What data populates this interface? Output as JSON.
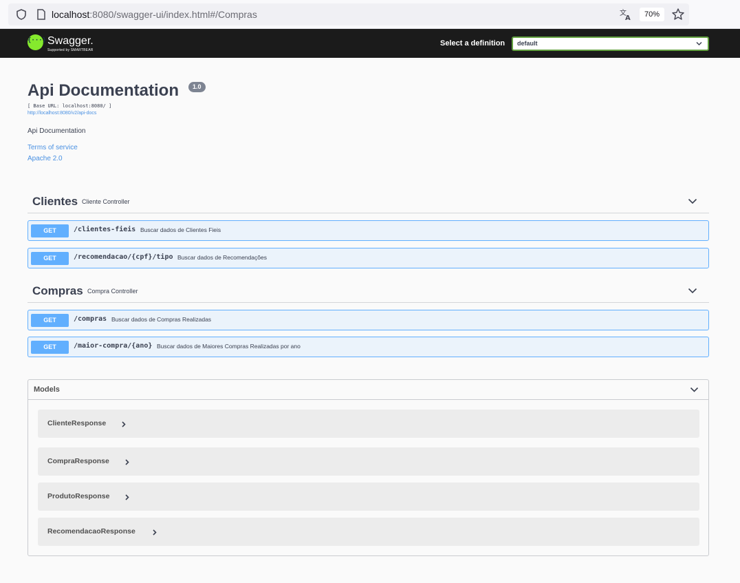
{
  "browser": {
    "url_host": "localhost",
    "url_rest": ":8080/swagger-ui/index.html#/Compras",
    "zoom": "70%"
  },
  "topbar": {
    "logo_icon_text": "{···}",
    "logo_title": "Swagger.",
    "logo_subtitle": "Supported by SMARTBEAR",
    "definition_label": "Select a definition",
    "definition_value": "default"
  },
  "info": {
    "title": "Api Documentation",
    "version": "1.0",
    "base_url": "[ Base URL: localhost:8080/ ]",
    "api_docs_link": "http://localhost:8080/v2/api-docs",
    "description": "Api Documentation",
    "terms_link": "Terms of service",
    "license_link": "Apache 2.0"
  },
  "tags": [
    {
      "name": "Clientes",
      "description": "Cliente Controller",
      "operations": [
        {
          "method": "GET",
          "path": "/clientes-fieis",
          "summary": "Buscar dados de Clientes Fieis"
        },
        {
          "method": "GET",
          "path": "/recomendacao/{cpf}/tipo",
          "summary": "Buscar dados de Recomendações"
        }
      ]
    },
    {
      "name": "Compras",
      "description": "Compra Controller",
      "operations": [
        {
          "method": "GET",
          "path": "/compras",
          "summary": "Buscar dados de Compras Realizadas"
        },
        {
          "method": "GET",
          "path": "/maior-compra/{ano}",
          "summary": "Buscar dados de Maiores Compras Realizadas por ano"
        }
      ]
    }
  ],
  "models": {
    "title": "Models",
    "items": [
      {
        "name": "ClienteResponse"
      },
      {
        "name": "CompraResponse"
      },
      {
        "name": "ProdutoResponse"
      },
      {
        "name": "RecomendacaoResponse"
      }
    ]
  },
  "colors": {
    "get_method": "#61affe",
    "get_bg": "#ebf3fb",
    "topbar": "#1b1b1b",
    "logo": "#85ea2d",
    "link": "#4990e2"
  }
}
